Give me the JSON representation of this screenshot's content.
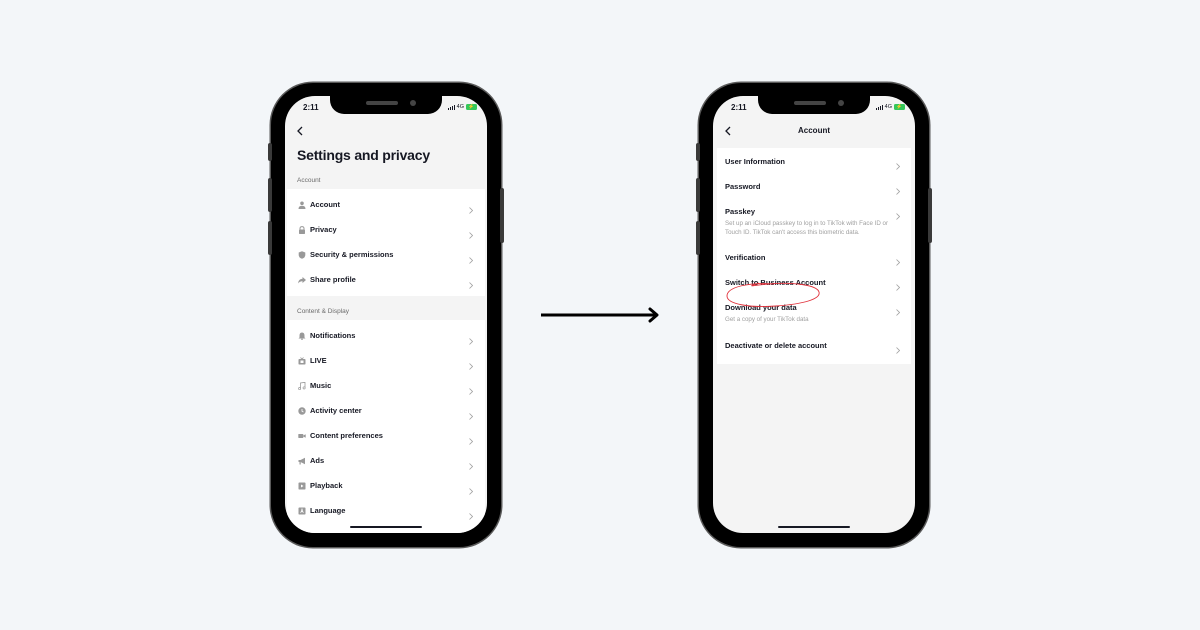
{
  "colors": {
    "background": "#f3f6f9",
    "screen_bg": "#f4f4f4",
    "phone_frame": "#000000",
    "highlight_ellipse": "#e0303a",
    "battery": "#34c759"
  },
  "status_bar": {
    "time": "2:11",
    "network": "4G",
    "battery_icon": "battery-charging-icon"
  },
  "left_screen": {
    "back_icon": "chevron-left-icon",
    "title": "Settings and privacy",
    "sections": [
      {
        "label": "Account",
        "items": [
          {
            "label": "Account",
            "icon": "person-icon"
          },
          {
            "label": "Privacy",
            "icon": "lock-icon"
          },
          {
            "label": "Security & permissions",
            "icon": "shield-icon"
          },
          {
            "label": "Share profile",
            "icon": "share-icon"
          }
        ]
      },
      {
        "label": "Content & Display",
        "items": [
          {
            "label": "Notifications",
            "icon": "bell-icon"
          },
          {
            "label": "LIVE",
            "icon": "tv-icon"
          },
          {
            "label": "Music",
            "icon": "music-note-icon"
          },
          {
            "label": "Activity center",
            "icon": "clock-icon"
          },
          {
            "label": "Content preferences",
            "icon": "video-camera-icon"
          },
          {
            "label": "Ads",
            "icon": "megaphone-icon"
          },
          {
            "label": "Playback",
            "icon": "play-square-icon"
          },
          {
            "label": "Language",
            "icon": "language-icon"
          }
        ]
      }
    ]
  },
  "transition_arrow": "arrow-right-icon",
  "right_screen": {
    "back_icon": "chevron-left-icon",
    "title": "Account",
    "items": [
      {
        "label": "User Information"
      },
      {
        "label": "Password"
      },
      {
        "label": "Passkey",
        "sub": "Set up an iCloud passkey to log in to TikTok with Face ID or Touch ID. TikTok can't access this biometric data."
      },
      {
        "label": "Verification"
      },
      {
        "label": "Switch to Business Account",
        "highlighted": true
      },
      {
        "label": "Download your data",
        "sub": "Get a copy of your TikTok data"
      },
      {
        "label": "Deactivate or delete account"
      }
    ]
  }
}
